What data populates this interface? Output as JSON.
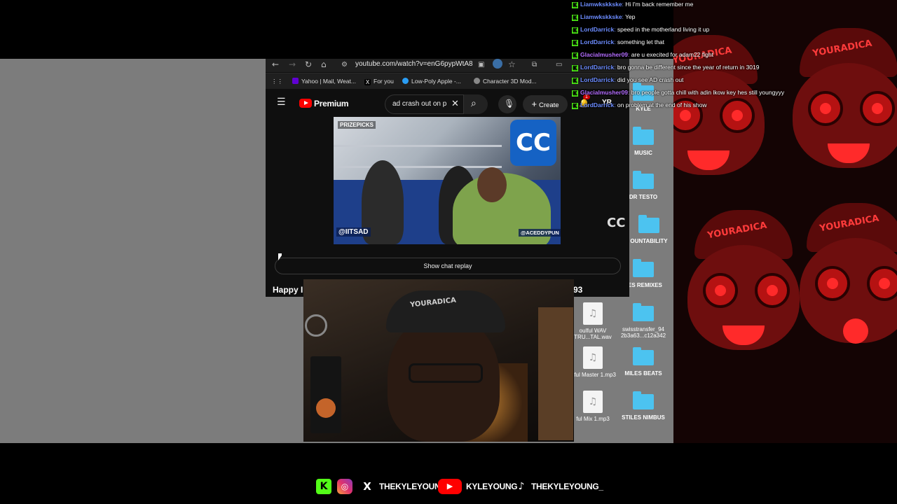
{
  "browser": {
    "url": "youtube.com/watch?v=enG6pypWtA8",
    "bookmarks": [
      {
        "label": "Yahoo | Mail, Weat..."
      },
      {
        "label": "For you"
      },
      {
        "label": "Low-Poly Apple -..."
      },
      {
        "label": "Character 3D Mod..."
      }
    ]
  },
  "youtube": {
    "brand": "Premium",
    "search_value": "ad crash out on p",
    "create_label": "Create",
    "notification_count": "1",
    "avatar_text": "YR",
    "video_watermarks": {
      "top": "PRIZEPICKS",
      "left": "@IITSAD",
      "right": "@ACEDDYPUN"
    },
    "show_chat_replay": "Show chat replay",
    "title_start": "Happy I",
    "title_end": "93"
  },
  "desktop": {
    "icons": [
      {
        "label": "KYLE"
      },
      {
        "label": "MUSIC"
      },
      {
        "label": "DR TESTO"
      },
      {
        "label": "OUNTABILITY"
      },
      {
        "label": "LES REMIXES"
      },
      {
        "label": "oulful WAV TRU...TAL.wav"
      },
      {
        "label": "swisstransfer_94 2b3a63...c12a342"
      },
      {
        "label": "ulful Master 1.mp3"
      },
      {
        "label": "MILES BEATS"
      },
      {
        "label": "ful Mix 1.mp3"
      },
      {
        "label": "STILES NIMBUS"
      }
    ]
  },
  "webcam": {
    "cap_text": "YOURADICA"
  },
  "background": {
    "cap_text": "YOURADICA"
  },
  "chat": {
    "messages": [
      {
        "user": "Liamwkskkske",
        "color": "#6c8cff",
        "text": "Hi I'm back remember me"
      },
      {
        "user": "Liamwkskkske",
        "color": "#6c8cff",
        "text": "Yep"
      },
      {
        "user": "LordDarrick",
        "color": "#6c8cff",
        "text": "speed in the motherland living it up"
      },
      {
        "user": "LordDarrick",
        "color": "#6c8cff",
        "text": "something let that"
      },
      {
        "user": "Glacialmusher09",
        "color": "#b36cff",
        "text": "are u execited for adam22 fight"
      },
      {
        "user": "LordDarrick",
        "color": "#6c8cff",
        "text": "bro gonna be different since the year of return in 3019"
      },
      {
        "user": "LordDarrick",
        "color": "#6c8cff",
        "text": "did you see AD crash out"
      },
      {
        "user": "Glacialmusher09",
        "color": "#b36cff",
        "text": "bro people gotta chill with adin lkow key hes still youngyyy"
      },
      {
        "user": "LordDarrick",
        "color": "#6c8cff",
        "text": "on problem at the end of his show"
      }
    ]
  },
  "socials": {
    "handles": [
      {
        "platform": "kick",
        "icon": "kick-icon",
        "text": ""
      },
      {
        "platform": "instagram",
        "icon": "instagram-icon",
        "text": ""
      },
      {
        "platform": "x",
        "icon": "x-icon",
        "text": "THEKYLEYOUNG"
      },
      {
        "platform": "youtube",
        "icon": "youtube-icon",
        "text": "KYLEYOUNG"
      },
      {
        "platform": "tiktok",
        "icon": "tiktok-icon",
        "text": "THEKYLEYOUNG_"
      }
    ]
  },
  "colors": {
    "kick_green": "#53fc18",
    "youtube_red": "#ff0000",
    "folder_blue": "#4cc3f0",
    "bg_red": "#b51212"
  }
}
